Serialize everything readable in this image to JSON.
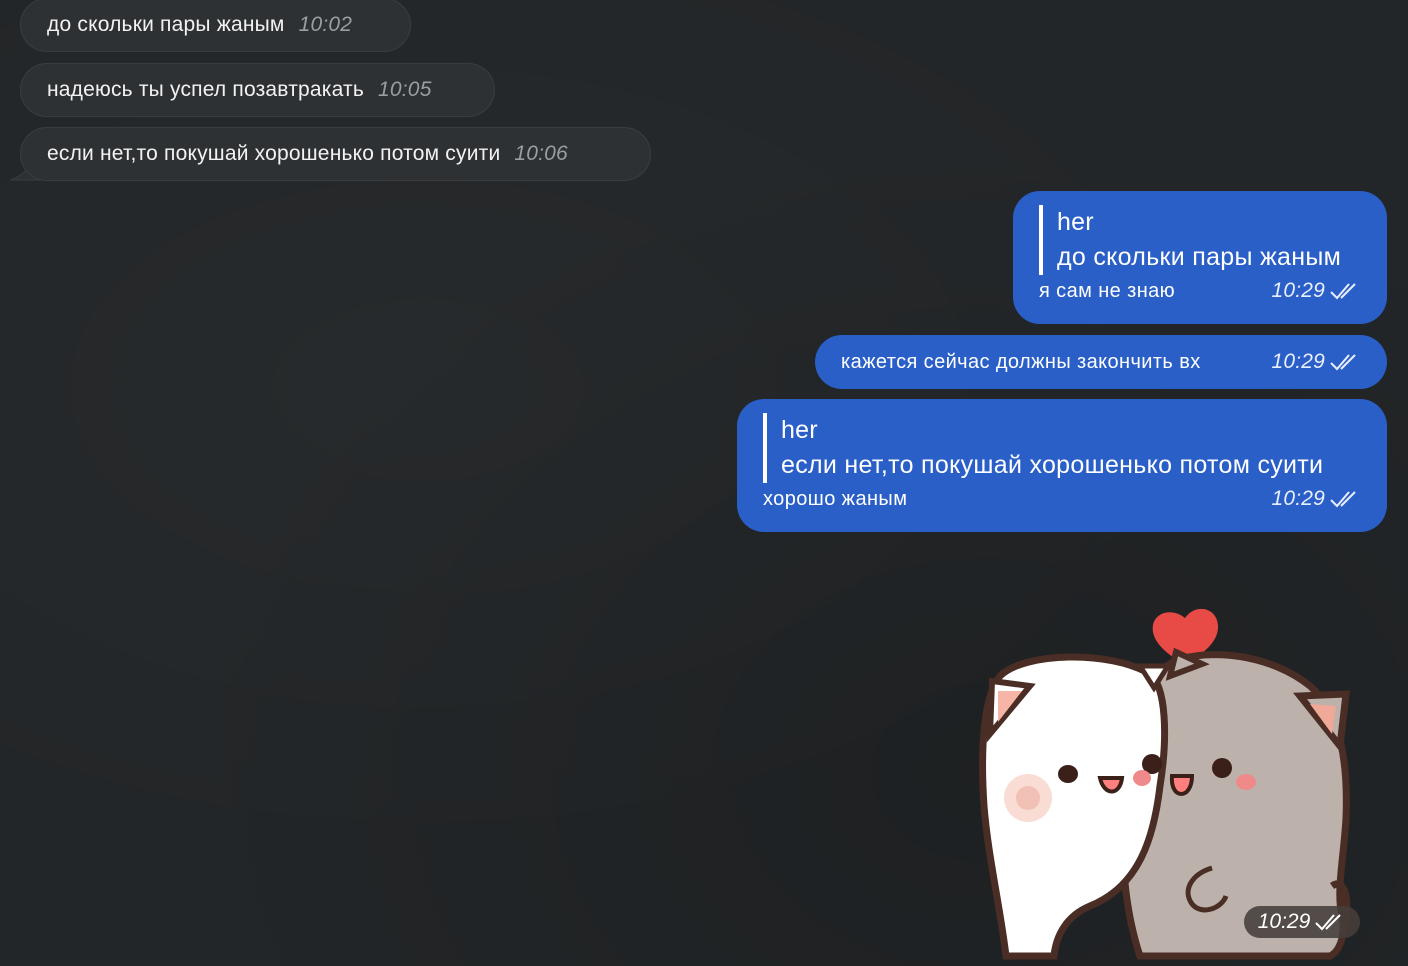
{
  "incoming": [
    {
      "text": "до скольки пары жаным",
      "time": "10:02"
    },
    {
      "text": "надеюсь ты успел позавтракать",
      "time": "10:05"
    },
    {
      "text": "если нет,то покушай хорошенько потом суити",
      "time": "10:06"
    }
  ],
  "outgoing": [
    {
      "reply_name": "her",
      "reply_text": "до скольки пары жаным",
      "text": "я сам не знаю",
      "time": "10:29"
    },
    {
      "text": "кажется сейчас должны закончить вх",
      "time": "10:29"
    },
    {
      "reply_name": "her",
      "reply_text": "если нет,то покушай хорошенько потом суити",
      "text": "хорошо жаным",
      "time": "10:29"
    }
  ],
  "sticker": {
    "time": "10:29",
    "icon": "cats-hug-sticker"
  },
  "colors": {
    "background": "#232628",
    "incoming_bubble": "#2e3133",
    "outgoing_bubble": "#2a5fc8",
    "heart": "#e84a45"
  }
}
